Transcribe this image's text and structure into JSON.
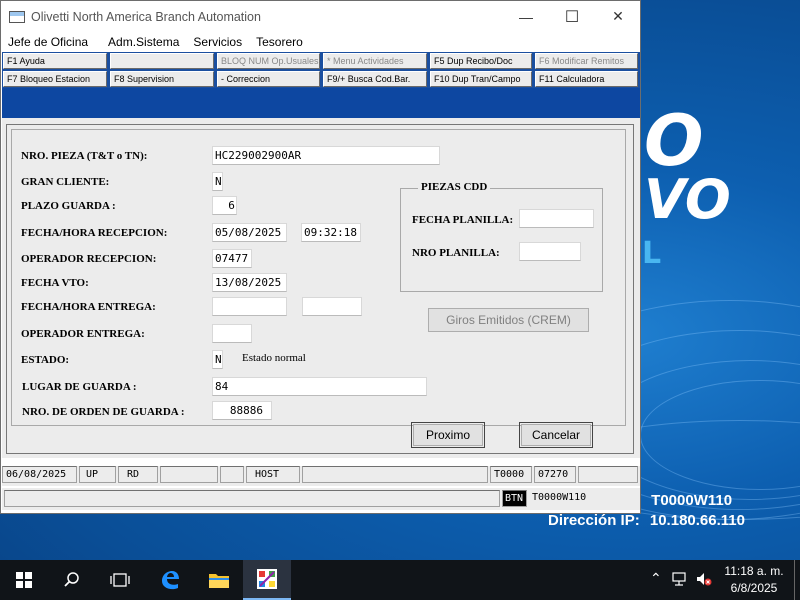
{
  "window": {
    "title": "Olivetti North America Branch Automation",
    "minimize_glyph": "—",
    "maximize_glyph": "☐",
    "close_glyph": "✕"
  },
  "menu": [
    "Jefe de Oficina",
    "Adm.Sistema",
    "Servicios",
    "Tesorero"
  ],
  "fkeys_row1": [
    "F1 Ayuda",
    "",
    "BLOQ NUM Op.Usuales",
    "* Menu Actividades",
    "F5 Dup Recibo/Doc",
    "F6 Modificar Remitos"
  ],
  "fkeys_row2": [
    "F7 Bloqueo Estacion",
    "F8 Supervision",
    "- Correccion",
    "F9/+ Busca Cod.Bar.",
    "F10 Dup Tran/Campo",
    "F11 Calculadora"
  ],
  "form": {
    "nro_pieza_label": "NRO.  PIEZA (T&T o TN):",
    "nro_pieza": "HC229002900AR",
    "gran_cliente_label": "GRAN CLIENTE:",
    "gran_cliente": "N",
    "plazo_guarda_label": "PLAZO GUARDA :",
    "plazo_guarda": "6",
    "fecha_recepcion_label": "FECHA/HORA RECEPCION:",
    "fecha_recepcion": "05/08/2025",
    "hora_recepcion": "09:32:18",
    "operador_recepcion_label": "OPERADOR RECEPCION:",
    "operador_recepcion": "07477",
    "fecha_vto_label": "FECHA VTO:",
    "fecha_vto": "13/08/2025",
    "fecha_entrega_label": "FECHA/HORA ENTREGA:",
    "fecha_entrega": "",
    "hora_entrega": "",
    "operador_entrega_label": "OPERADOR ENTREGA:",
    "operador_entrega": "",
    "estado_label": "ESTADO:",
    "estado": "N",
    "estado_desc": "Estado normal",
    "lugar_guarda_label": "LUGAR DE GUARDA :",
    "lugar_guarda": "84",
    "nro_orden_label": "NRO. DE ORDEN  DE GUARDA :",
    "nro_orden": "88886"
  },
  "piezas_cdd": {
    "title": "PIEZAS CDD",
    "fecha_planilla_label": "FECHA PLANILLA:",
    "fecha_planilla": "",
    "nro_planilla_label": "NRO PLANILLA:",
    "nro_planilla": ""
  },
  "buttons": {
    "giros": "Giros Emitidos (CREM)",
    "proximo": "Proximo",
    "cancelar": "Cancelar"
  },
  "status": {
    "date": "06/08/2025",
    "up": "UP",
    "rd": "RD",
    "host": "HOST",
    "terminal": "T0000",
    "code": "07270",
    "btn": "BTN",
    "station": "T0000W110"
  },
  "desktop": {
    "brand_line1": "O",
    "brand_line2": "VO",
    "brand_line3": "L",
    "host_label": ":",
    "host_value": "T0000W110",
    "ip_label": "Dirección IP:",
    "ip_value": "10.180.66.110"
  },
  "taskbar": {
    "time": "11:18 a. m.",
    "date": "6/8/2025"
  },
  "colors": {
    "fkey_bar": "#1b4f9f",
    "desktop": "#0d5fb0"
  }
}
